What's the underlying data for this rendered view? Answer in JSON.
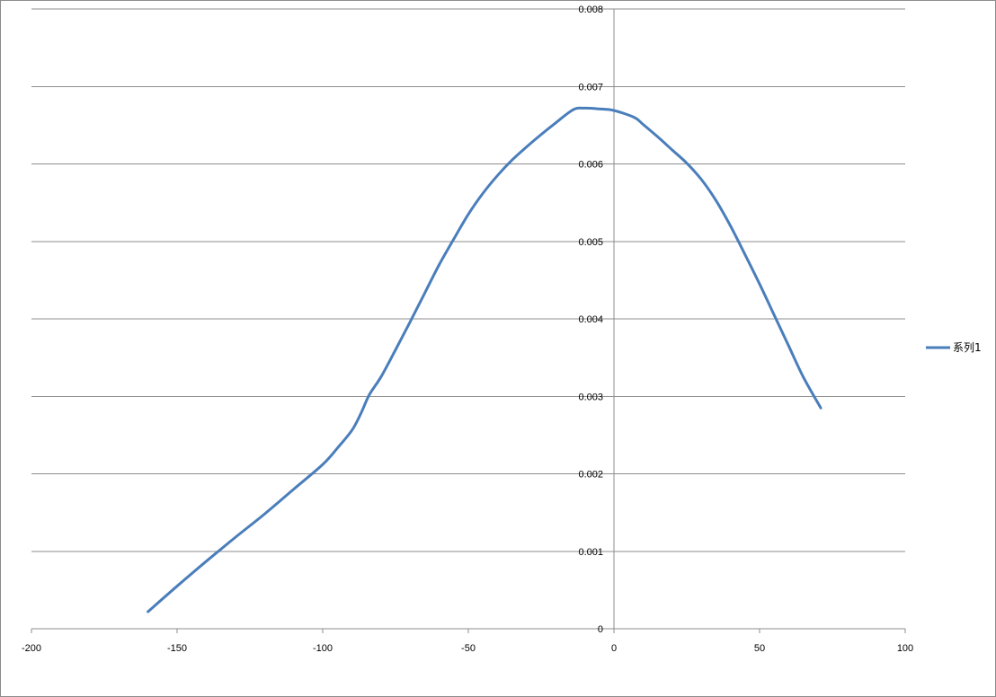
{
  "chart_data": {
    "type": "scatter-line",
    "title": "",
    "xlabel": "",
    "ylabel": "",
    "xlim": [
      -200,
      100
    ],
    "ylim": [
      0,
      0.008
    ],
    "x_ticks": [
      "-200",
      "-150",
      "-100",
      "-50",
      "0",
      "50",
      "100"
    ],
    "y_ticks": [
      "0",
      "0.001",
      "0.002",
      "0.003",
      "0.004",
      "0.005",
      "0.006",
      "0.007",
      "0.008"
    ],
    "grid": "horizontal",
    "legend_position": "right",
    "series": [
      {
        "name": "系列1",
        "color": "#4a7ebb",
        "x": [
          -160,
          -150,
          -140,
          -130,
          -120,
          -110,
          -100,
          -95,
          -90,
          -87,
          -84,
          -80,
          -75,
          -70,
          -65,
          -60,
          -55,
          -50,
          -45,
          -40,
          -35,
          -30,
          -25,
          -20,
          -14,
          -10,
          -5,
          0,
          7,
          10,
          15,
          20,
          25,
          30,
          35,
          40,
          45,
          50,
          55,
          60,
          65,
          71
        ],
        "y": [
          0.00022,
          0.00055,
          0.00087,
          0.00118,
          0.00148,
          0.0018,
          0.00212,
          0.00233,
          0.00256,
          0.00277,
          0.00302,
          0.00325,
          0.0036,
          0.00396,
          0.00433,
          0.0047,
          0.00503,
          0.00535,
          0.00562,
          0.00585,
          0.00605,
          0.00622,
          0.00638,
          0.00653,
          0.0067,
          0.00672,
          0.00671,
          0.00669,
          0.0066,
          0.00651,
          0.00635,
          0.00618,
          0.00601,
          0.0058,
          0.00553,
          0.0052,
          0.00483,
          0.00445,
          0.00405,
          0.00365,
          0.00325,
          0.00285
        ]
      }
    ]
  }
}
